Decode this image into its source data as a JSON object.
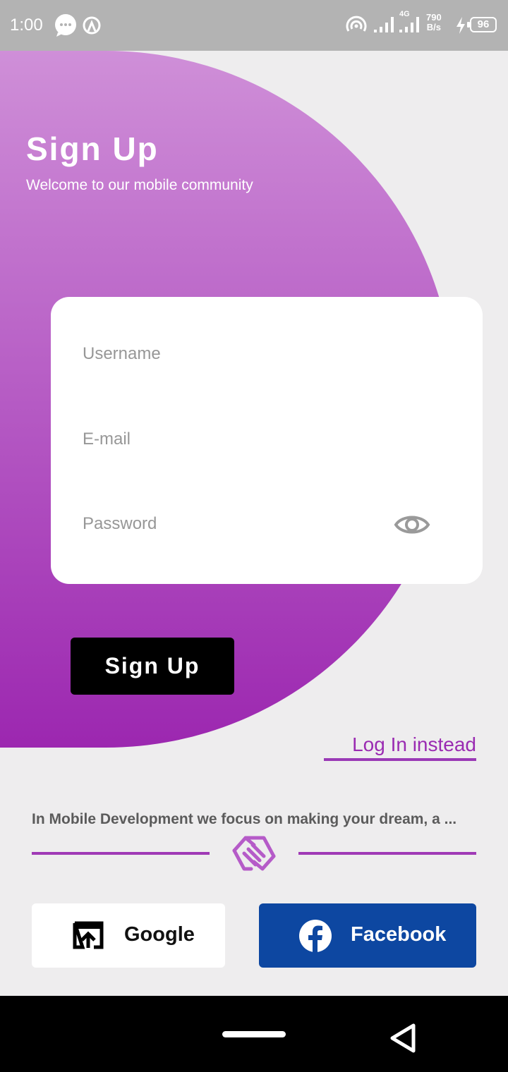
{
  "status_bar": {
    "time": "1:00",
    "network_type": "4G",
    "net_speed_value": "790",
    "net_speed_unit": "B/s",
    "battery_level": "96",
    "icons": [
      "chat-bubble-icon",
      "hotspot-icon",
      "wifi-icon",
      "signal-icon",
      "charging-icon"
    ]
  },
  "header": {
    "title": "Sign Up",
    "subtitle": "Welcome to our mobile community"
  },
  "form": {
    "username_placeholder": "Username",
    "username_value": "",
    "email_placeholder": "E-mail",
    "email_value": "",
    "password_placeholder": "Password",
    "password_value": ""
  },
  "actions": {
    "signup_label": "Sign Up",
    "login_link_label": "Log In instead"
  },
  "tagline": "In Mobile Development we focus on making your dream, a ...",
  "social": {
    "google_label": "Google",
    "facebook_label": "Facebook"
  },
  "colors": {
    "accent": "#9c27b0",
    "gradient_top": "#cf8fd8",
    "gradient_bottom": "#9c27b0",
    "facebook_blue": "#0d47a1",
    "background": "#eeedee",
    "status_bar": "#b3b3b3"
  }
}
